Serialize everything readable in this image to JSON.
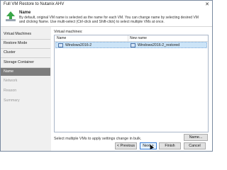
{
  "window": {
    "title": "Full VM Restore to Nutanix AHV",
    "close_glyph": "✕"
  },
  "header": {
    "step_title": "Name",
    "description": "By default, original VM name is selected as the name for each VM. You can change name by selecting desired VM and clicking Name. Use multi-select (Ctrl-click and Shift-click) to select multiple VMs at once.",
    "logo_icon": "green-arrow-up-icon"
  },
  "sidebar": {
    "items": [
      {
        "label": "Virtual Machines",
        "state": "normal"
      },
      {
        "label": "Restore Mode",
        "state": "normal"
      },
      {
        "label": "Cluster",
        "state": "normal"
      },
      {
        "label": "Storage Container",
        "state": "normal"
      },
      {
        "label": "Name",
        "state": "active"
      },
      {
        "label": "Network",
        "state": "disabled"
      },
      {
        "label": "Reason",
        "state": "disabled"
      },
      {
        "label": "Summary",
        "state": "disabled"
      }
    ]
  },
  "main": {
    "vm_label": "Virtual machines:",
    "columns": [
      "Name",
      "New name"
    ],
    "rows": [
      {
        "name": "Windows2016-2",
        "new_name": "Windows2016-2_restored"
      }
    ],
    "hint": "Select multiple VMs to apply settings change in bulk.",
    "name_button": "Name..."
  },
  "footer": {
    "previous": "< Previous",
    "next": "Next >",
    "finish": "Finish",
    "cancel": "Cancel"
  },
  "colors": {
    "active_step_bg": "#7d7d7d",
    "selected_row_bg": "#cce4f7",
    "default_button_border": "#3c7fd6"
  }
}
